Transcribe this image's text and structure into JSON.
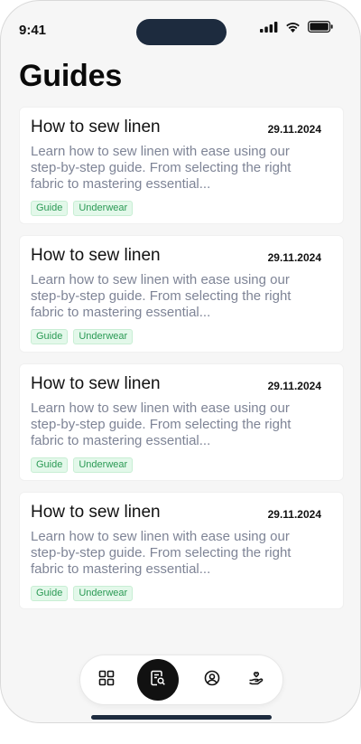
{
  "status": {
    "time": "9:41"
  },
  "page": {
    "title": "Guides"
  },
  "guides": [
    {
      "title": "How to sew linen",
      "date": "29.11.2024",
      "description": "Learn how to sew linen with ease using our step-by-step guide. From selecting the right fabric to mastering essential...",
      "tags": [
        "Guide",
        "Underwear"
      ]
    },
    {
      "title": "How to sew linen",
      "date": "29.11.2024",
      "description": "Learn how to sew linen with ease using our step-by-step guide. From selecting the right fabric to mastering essential...",
      "tags": [
        "Guide",
        "Underwear"
      ]
    },
    {
      "title": "How to sew linen",
      "date": "29.11.2024",
      "description": "Learn how to sew linen with ease using our step-by-step guide. From selecting the right fabric to mastering essential...",
      "tags": [
        "Guide",
        "Underwear"
      ]
    },
    {
      "title": "How to sew linen",
      "date": "29.11.2024",
      "description": "Learn how to sew linen with ease using our step-by-step guide. From selecting the right fabric to mastering essential...",
      "tags": [
        "Guide",
        "Underwear"
      ]
    }
  ],
  "nav": {
    "items": [
      {
        "icon": "grid-icon",
        "active": false
      },
      {
        "icon": "guide-search-icon",
        "active": true
      },
      {
        "icon": "profile-icon",
        "active": false
      },
      {
        "icon": "hand-heart-icon",
        "active": false
      }
    ]
  },
  "colors": {
    "tag_text": "#2b9a55",
    "tag_bg": "#e3f8ea",
    "nav_active": "#111111",
    "description": "#7e8496"
  }
}
